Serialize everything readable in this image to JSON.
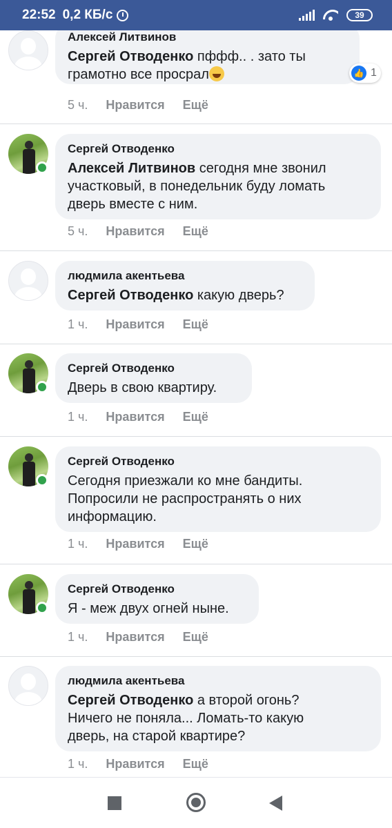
{
  "status_bar": {
    "time": "22:52",
    "speed": "0,2 КБ/с",
    "battery": "39"
  },
  "comments": [
    {
      "author": "Алексей Литвинов",
      "mention": "Сергей Отводенко",
      "text_lines": [
        "пффф.. . зато ты",
        "грамотно все просрал"
      ],
      "emoji": "rolling-on-floor-laughing",
      "time": "5 ч.",
      "like_label": "Нравится",
      "more_label": "Ещё",
      "reaction_count": "1",
      "avatar": "default",
      "online": false
    },
    {
      "author": "Сергей Отводенко",
      "mention": "Алексей Литвинов",
      "text_lines": [
        "сегодня мне звонил",
        "участковый, в понедельник буду ломать",
        "дверь вместе с ним."
      ],
      "time": "5 ч.",
      "like_label": "Нравится",
      "more_label": "Ещё",
      "avatar": "photo",
      "online": true
    },
    {
      "author": "людмила акентьева",
      "mention": "Сергей Отводенко",
      "text_lines": [
        "какую дверь?"
      ],
      "time": "1 ч.",
      "like_label": "Нравится",
      "more_label": "Ещё",
      "avatar": "default",
      "online": false
    },
    {
      "author": "Сергей Отводенко",
      "mention": "",
      "text_lines": [
        "Дверь в свою квартиру."
      ],
      "time": "1 ч.",
      "like_label": "Нравится",
      "more_label": "Ещё",
      "avatar": "photo",
      "online": true
    },
    {
      "author": "Сергей Отводенко",
      "mention": "",
      "text_lines": [
        "Сегодня приезжали ко мне бандиты.",
        "Попросили не распространять о них",
        "информацию."
      ],
      "time": "1 ч.",
      "like_label": "Нравится",
      "more_label": "Ещё",
      "avatar": "photo",
      "online": true
    },
    {
      "author": "Сергей Отводенко",
      "mention": "",
      "text_lines": [
        "Я - меж двух огней ныне."
      ],
      "time": "1 ч.",
      "like_label": "Нравится",
      "more_label": "Ещё",
      "avatar": "photo",
      "online": true
    },
    {
      "author": "людмила акентьева",
      "mention": "Сергей Отводенко",
      "text_lines": [
        "а второй огонь?",
        "Ничего не поняла... Ломать-то какую",
        "дверь, на старой квартире?"
      ],
      "time": "1 ч.",
      "like_label": "Нравится",
      "more_label": "Ещё",
      "avatar": "default",
      "online": false
    }
  ],
  "navigation": {
    "recents": "recents-square-icon",
    "home": "home-circle-icon",
    "back": "back-triangle-icon"
  },
  "colors": {
    "status_bar": "#3b5998",
    "bubble": "#f0f2f5",
    "meta_text": "#8a8d91",
    "online": "#31a24c",
    "like": "#1877f2"
  }
}
